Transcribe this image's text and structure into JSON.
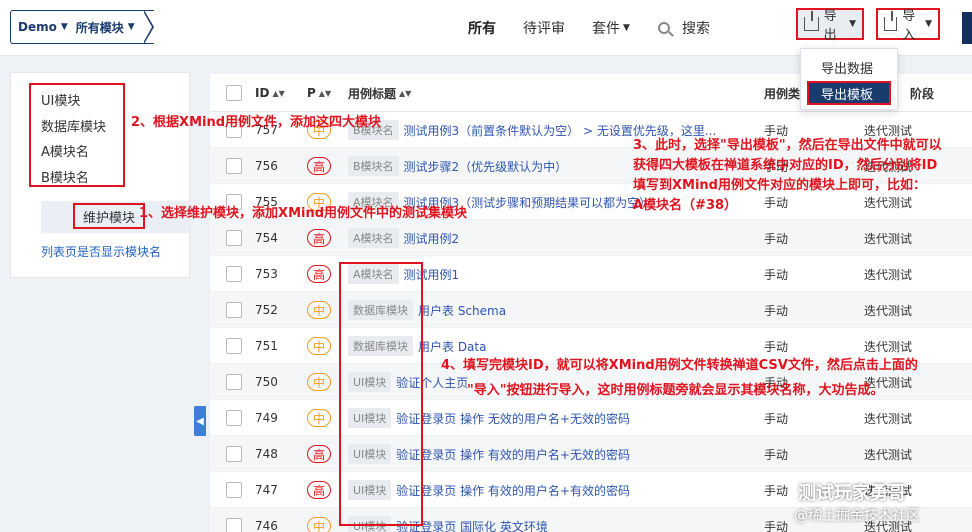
{
  "header": {
    "product": "Demo",
    "module": "所有模块",
    "nav": {
      "all": "所有",
      "review": "待评审",
      "suite": "套件",
      "search": "搜索"
    },
    "export_label": "导出",
    "import_label": "导入"
  },
  "export_menu": {
    "data": "导出数据",
    "template": "导出模板"
  },
  "sidebar": {
    "modules": [
      "UI模块",
      "数据库模块",
      "A模块名",
      "B模块名"
    ],
    "maintain": "维护模块",
    "show_module": "列表页是否显示模块名"
  },
  "table": {
    "headers": {
      "id": "ID",
      "p": "P",
      "title": "用例标题",
      "type": "用例类",
      "stage": "阶段"
    },
    "rows": [
      {
        "id": "757",
        "p": "中",
        "tag": "B模块名",
        "title": "测试用例3（前置条件默认为空） > 无设置优先级，这里...",
        "type": "手动",
        "stage": "迭代测试"
      },
      {
        "id": "756",
        "p": "高",
        "tag": "B模块名",
        "title": "测试步骤2（优先级默认为中）",
        "type": "手动",
        "stage": "迭代测试"
      },
      {
        "id": "755",
        "p": "中",
        "tag": "A模块名",
        "title": "测试用例3（测试步骤和预期结果可以都为空）",
        "type": "手动",
        "stage": "迭代测试"
      },
      {
        "id": "754",
        "p": "高",
        "tag": "A模块名",
        "title": "测试用例2",
        "type": "手动",
        "stage": "迭代测试"
      },
      {
        "id": "753",
        "p": "高",
        "tag": "A模块名",
        "title": "测试用例1",
        "type": "手动",
        "stage": "迭代测试"
      },
      {
        "id": "752",
        "p": "中",
        "tag": "数据库模块",
        "title": "用户表 Schema",
        "type": "手动",
        "stage": "迭代测试"
      },
      {
        "id": "751",
        "p": "中",
        "tag": "数据库模块",
        "title": "用户表 Data",
        "type": "手动",
        "stage": "迭代测试"
      },
      {
        "id": "750",
        "p": "中",
        "tag": "UI模块",
        "title": "验证个人主页",
        "type": "手动",
        "stage": "迭代测试"
      },
      {
        "id": "749",
        "p": "中",
        "tag": "UI模块",
        "title": "验证登录页 操作 无效的用户名+无效的密码",
        "type": "手动",
        "stage": "迭代测试"
      },
      {
        "id": "748",
        "p": "高",
        "tag": "UI模块",
        "title": "验证登录页 操作 有效的用户名+无效的密码",
        "type": "手动",
        "stage": "迭代测试"
      },
      {
        "id": "747",
        "p": "高",
        "tag": "UI模块",
        "title": "验证登录页 操作 有效的用户名+有效的密码",
        "type": "手动",
        "stage": "迭代测试"
      },
      {
        "id": "746",
        "p": "中",
        "tag": "UI模块",
        "title": "验证登录页 国际化 英文环境",
        "type": "手动",
        "stage": "迭代测试"
      }
    ]
  },
  "annotations": {
    "a1": "1、选择维护模块，添加XMind用例文件中的测试集模块",
    "a2": "2、根据XMind用例文件，添加这四大模块",
    "a3_l1": "3、此时，选择\"导出模板\"，然后在导出文件中就可以",
    "a3_l2": "获得四大模板在禅道系统中对应的ID，然后分别将ID",
    "a3_l3": "填写到XMind用例文件对应的模块上即可，比如：",
    "a3_l4": "A模块名（#38）",
    "a4_l1": "4、填写完模块ID，就可以将XMind用例文件转换禅道CSV文件，然后点击上面的",
    "a4_l2": "\"导入\"按钮进行导入，这时用例标题旁就会显示其模块名称，大功告成。"
  },
  "watermark": {
    "line1": "测试玩家勇哥",
    "line2": "@稀土掘金技术社区"
  },
  "colors": {
    "annotation": "#e0141e",
    "nav_dark": "#1a3b6e",
    "link": "#2e56b0",
    "priority_mid": "#f39b22"
  }
}
